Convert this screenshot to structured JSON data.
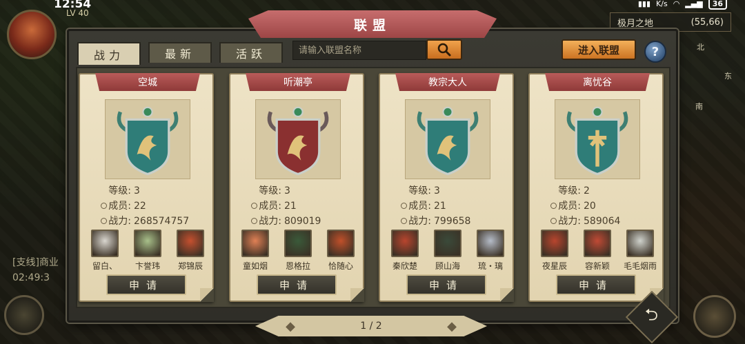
{
  "status": {
    "time": "12:54",
    "net_speed": "K/s",
    "battery": "36"
  },
  "player": {
    "level": "LV 40"
  },
  "location": {
    "name": "极月之地",
    "coords": "(55,66)"
  },
  "compass": {
    "north": "北",
    "east": "东",
    "south": "南"
  },
  "chat": [
    "[支线]商业",
    "02:49:3"
  ],
  "panel": {
    "title": "联盟"
  },
  "tabs": [
    {
      "label": "战力",
      "active": true
    },
    {
      "label": "最新",
      "active": false
    },
    {
      "label": "活跃",
      "active": false
    }
  ],
  "search": {
    "placeholder": "请输入联盟名称",
    "button_icon": "search-icon"
  },
  "join_button": "进入联盟",
  "help_button": "?",
  "labels": {
    "level": "等级:",
    "members": "成员:",
    "power": "战力:",
    "apply": "申请"
  },
  "alliances": [
    {
      "name": "空城",
      "crest": "teal",
      "level": "3",
      "members": "22",
      "power": "268574757",
      "top_members": [
        "留白、",
        "卞誉玮",
        "郑锦辰"
      ]
    },
    {
      "name": "听潮亭",
      "crest": "red",
      "level": "3",
      "members": "21",
      "power": "809019",
      "top_members": [
        "童如烟",
        "恩格拉",
        "恰随心"
      ]
    },
    {
      "name": "教宗大人",
      "crest": "teal",
      "level": "3",
      "members": "21",
      "power": "799658",
      "top_members": [
        "秦欣楚",
        "顾山海",
        "琉・璃"
      ]
    },
    {
      "name": "离忧谷",
      "crest": "teal-sword",
      "level": "2",
      "members": "20",
      "power": "589064",
      "top_members": [
        "夜星辰",
        "容新颖",
        "毛毛烟雨"
      ]
    }
  ],
  "pager": {
    "text": "1 / 2"
  },
  "colors": {
    "ribbon": "#9d4646",
    "button_orange": "#e08a35",
    "card_bg": "#e8dcbc"
  }
}
